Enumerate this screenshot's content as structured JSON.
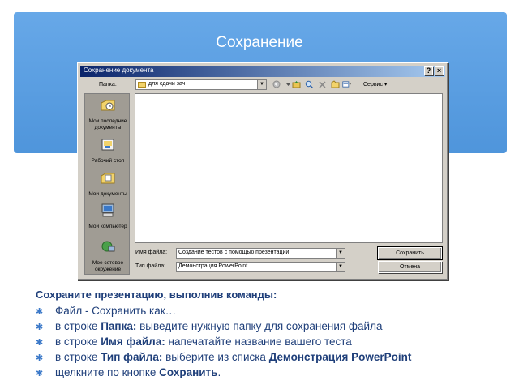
{
  "slide": {
    "title": "Сохранение"
  },
  "dialog": {
    "title": "Сохранение документа",
    "folder_label": "Папка:",
    "folder_value": "для сдачи зач",
    "views_label": "Сервис",
    "places": [
      {
        "label": "Мои последние документы",
        "icon": "history-icon"
      },
      {
        "label": "Рабочий стол",
        "icon": "desktop-icon"
      },
      {
        "label": "Мои документы",
        "icon": "my-documents-icon"
      },
      {
        "label": "Мой компьютер",
        "icon": "my-computer-icon"
      },
      {
        "label": "Мое сетевое окружение",
        "icon": "network-icon"
      }
    ],
    "filename_label": "Имя файла:",
    "filename_value": "Создание тестов с помощью презентаций",
    "filetype_label": "Тип файла:",
    "filetype_value": "Демонстрация PowerPoint",
    "save_button": "Сохранить",
    "cancel_button": "Отмена"
  },
  "instructions": {
    "heading": "Сохраните презентацию, выполнив команды:",
    "items": [
      {
        "pre": "Файл - Сохранить как…",
        "bold1": "",
        "mid": "",
        "bold2": "",
        "post": ""
      },
      {
        "pre": "в строке ",
        "bold1": "Папка:",
        "mid": " выведите нужную папку для сохранения файла",
        "bold2": "",
        "post": ""
      },
      {
        "pre": "в строке ",
        "bold1": "Имя файла:",
        "mid": " напечатайте название вашего теста",
        "bold2": "",
        "post": ""
      },
      {
        "pre": "в строке ",
        "bold1": "Тип файла:",
        "mid": " выберите из списка ",
        "bold2": "Демонстрация PowerPoint",
        "post": ""
      },
      {
        "pre": "щелкните по кнопке ",
        "bold1": "Сохранить",
        "mid": ".",
        "bold2": "",
        "post": ""
      }
    ]
  },
  "colors": {
    "header_band": "#5b9ee0",
    "instruction_text": "#1f3f7a",
    "bullet": "#3a78c8",
    "dialog_face": "#d4d0c8",
    "titlebar": "#0a246a"
  }
}
